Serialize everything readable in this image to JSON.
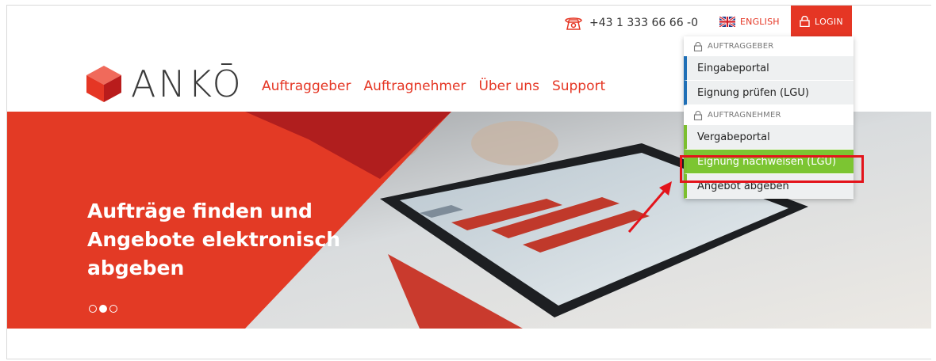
{
  "util": {
    "phone_icon": "telephone-icon",
    "phone": "+43 1 333 66 66 -0",
    "language": "ENGLISH",
    "login": "LOGIN"
  },
  "logo": {
    "text": "ANKŌ"
  },
  "nav": [
    {
      "label": "Auftraggeber"
    },
    {
      "label": "Auftragnehmer"
    },
    {
      "label": "Über uns"
    },
    {
      "label": "Support"
    }
  ],
  "hero": {
    "title": "Aufträge finden und Angebote elektronisch abgeben",
    "slides": 3,
    "active_slide": 2
  },
  "dropdown": {
    "group1": "AUFTRAGGEBER",
    "group1_items": [
      {
        "label": "Eingabeportal"
      },
      {
        "label": "Eignung prüfen (LGU)"
      }
    ],
    "group2": "AUFTRAGNEHMER",
    "group2_items": [
      {
        "label": "Vergabeportal"
      },
      {
        "label": "Eignung nachweisen (LGU)"
      },
      {
        "label": "Angebot abgeben"
      }
    ]
  },
  "colors": {
    "brand_red": "#e53624",
    "blue_accent": "#1f6fb6",
    "green_accent": "#7cbf2f",
    "highlight": "#e3141b"
  }
}
